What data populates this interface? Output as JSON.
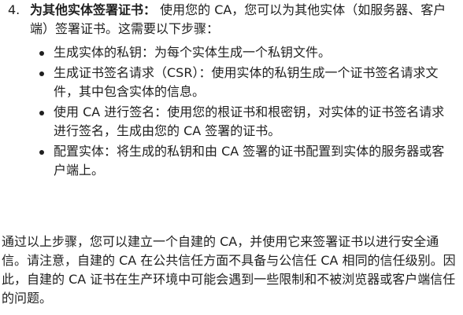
{
  "step": {
    "number": "4.",
    "title": "为其他实体签署证书：",
    "intro": " 使用您的 CA，您可以为其他实体（如服务器、客户端）签署证书。这需要以下步骤：",
    "bullets": [
      {
        "text": "生成实体的私钥：为每个实体生成一个私钥文件。"
      },
      {
        "text": "生成证书签名请求（CSR）：使用实体的私钥生成一个证书签名请求文件，其中包含实体的信息。"
      },
      {
        "text": "使用 CA 进行签名：使用您的根证书和根密钥，对实体的证书签名请求进行签名，生成由您的 CA 签署的证书。"
      },
      {
        "text": "配置实体：将生成的私钥和由 CA 签署的证书配置到实体的服务器或客户端上。"
      }
    ]
  },
  "summary": "通过以上步骤，您可以建立一个自建的 CA，并使用它来签署证书以进行安全通信。请注意，自建的 CA 在公共信任方面不具备与公信任 CA 相同的信任级别。因此，自建的 CA 证书在生产环境中可能会遇到一些限制和不被浏览器或客户端信任的问题。"
}
